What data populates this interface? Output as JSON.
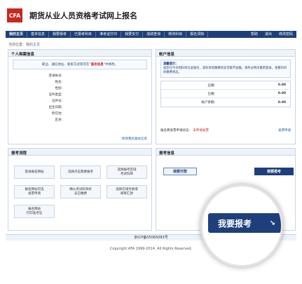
{
  "header": {
    "logo_text": "CFA",
    "title": "期货从业人员资格考试网上报名"
  },
  "nav": {
    "items": [
      "我的主页",
      "基本信息",
      "我要报考",
      "已报考科目",
      "准考证打印",
      "我要支付",
      "成绩查询",
      "修改科目",
      "报名须知"
    ],
    "right": [
      "帮助",
      "退出",
      "修改密码"
    ]
  },
  "breadcrumb": "当前位置：我的主页",
  "profile": {
    "title": "个人档案信息",
    "notice_prefix": "职业、通信地址、联系方式等可在",
    "notice_highlight": "基本信息",
    "notice_suffix": "中修改。",
    "fields": [
      "登录帐号：",
      "姓名：",
      "性别：",
      "证件类型：",
      "证件号：",
      "出生日期：",
      "所在地：",
      "区县："
    ],
    "edit_link": "修改我的基本信息"
  },
  "account": {
    "title": "帐户信息",
    "notice_title": "温馨提示：",
    "notice_body": "如您在今天则科目在此报名，或科目的缴费状态可能不准确，请务必明天重新登录，查看科目的缴费状态。",
    "rows": [
      {
        "label": "应缴：",
        "value": "0.00"
      },
      {
        "label": "已缴：",
        "value": "0.00"
      },
      {
        "label": "帐户余额：",
        "value": "0.00"
      }
    ],
    "invoice_label": "报名费发票申请状态：",
    "invoice_status": "未申请发票",
    "invoice_link": "发票申请"
  },
  "flow": {
    "title": "报考流程",
    "steps": [
      "登录报名网站",
      "选择点击我要报考",
      "选择报考区域\n考试科目",
      "报名网站可选\n发票申请",
      "确认考试科目状\n态已缴费",
      "选择在线付款或\n邮寄汇款",
      "报名网站\n打印准考证"
    ]
  },
  "exam": {
    "title": "报考信息",
    "pay_label": "我要付款",
    "apply_label": "我要报考"
  },
  "footer": {
    "icp": "京ICP备05065083号",
    "copyright": "Copyright ATA 1999-2014. All Rights Reserved."
  },
  "magnifier": {
    "label": "我要报考",
    "arrow": "↘"
  }
}
